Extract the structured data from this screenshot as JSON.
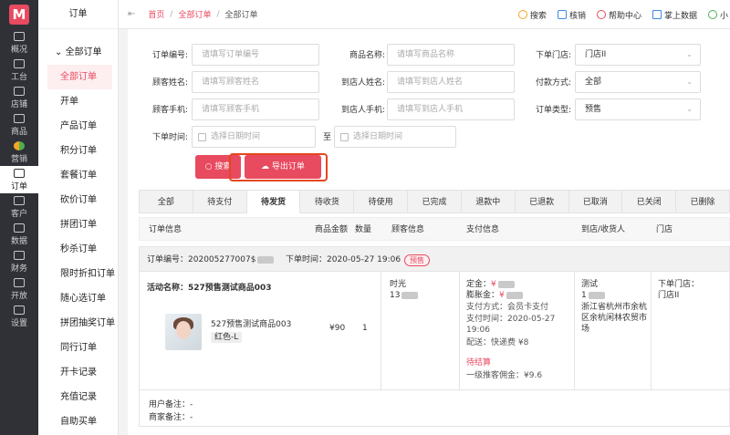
{
  "left_nav": {
    "items": [
      {
        "label": "概况"
      },
      {
        "label": "工台"
      },
      {
        "label": "店铺"
      },
      {
        "label": "商品"
      },
      {
        "label": "营销"
      },
      {
        "label": "订单"
      },
      {
        "label": "客户"
      },
      {
        "label": "数据"
      },
      {
        "label": "财务"
      },
      {
        "label": "开放"
      },
      {
        "label": "设置"
      }
    ]
  },
  "sub_nav": {
    "title": "订单",
    "group": "全部订单",
    "items": [
      "全部订单",
      "开单",
      "产品订单",
      "积分订单",
      "套餐订单",
      "砍价订单",
      "拼团订单",
      "秒杀订单",
      "限时折扣订单",
      "随心选订单",
      "拼团抽奖订单",
      "同行订单",
      "开卡记录",
      "充值记录",
      "自助买单"
    ]
  },
  "top": {
    "collapse_icon": "⇤",
    "breadcrumb": [
      "首页",
      "全部订单",
      "全部订单"
    ],
    "tools": [
      "搜索",
      "核销",
      "帮助中心",
      "掌上数据",
      "小"
    ]
  },
  "filters": {
    "order_no_label": "订单编号:",
    "order_no_ph": "请填写订单编号",
    "product_label": "商品名称:",
    "product_ph": "请填写商品名称",
    "store_label": "下单门店:",
    "store_value": "门店II",
    "customer_label": "顾客姓名:",
    "customer_ph": "请填写顾客姓名",
    "arrival_name_label": "到店人姓名:",
    "arrival_name_ph": "请填写到店人姓名",
    "pay_label": "付款方式:",
    "pay_value": "全部",
    "phone_label": "顾客手机:",
    "phone_ph": "请填写顾客手机",
    "arrival_phone_label": "到店人手机:",
    "arrival_phone_ph": "请填写到店人手机",
    "type_label": "订单类型:",
    "type_value": "预售",
    "time_label": "下单时间:",
    "time_start_ph": "选择日期时间",
    "time_to": "至",
    "time_end_ph": "选择日期时间",
    "search_btn": "搜索",
    "export_btn": "导出订单"
  },
  "tabs": [
    "全部",
    "待支付",
    "待发货",
    "待收货",
    "待使用",
    "已完成",
    "退款中",
    "已退款",
    "已取消",
    "已关闭",
    "已删除"
  ],
  "table_head": [
    "订单信息",
    "商品金额",
    "数量",
    "顾客信息",
    "支付信息",
    "到店/收货人",
    "门店"
  ],
  "order": {
    "no_label": "订单编号：",
    "no_value": "202005277007$",
    "time_label": "下单时间：",
    "time_value": "2020-05-27 19:06",
    "badge": "预售",
    "activity": "活动名称：527预售测试商品003",
    "product_name": "527预售测试商品003",
    "spec": "红色-L",
    "amount": "¥90",
    "qty": "1",
    "customer_name": "时光",
    "customer_phone": "13",
    "deposit_label": "定金：",
    "deposit": "¥",
    "expand_label": "膨胀金：",
    "expand": "¥",
    "pay_method": "支付方式：会员卡支付",
    "pay_time": "支付时间：2020-05-27 19:06",
    "shipping": "配送：快递费 ¥8",
    "settle": "待结算",
    "commission": "一级推客佣金：¥9.6",
    "receiver_name": "测试",
    "receiver_phone": "1",
    "address": "浙江省杭州市余杭区余杭闲林农贸市场",
    "store_label": "下单门店：",
    "store": "门店II"
  },
  "notes": {
    "user": "用户备注：-",
    "merchant": "商家备注：-"
  },
  "colors": {
    "accent": "#e84a5f",
    "highlight": "#e5471f",
    "nav_bg": "#2f3137"
  }
}
